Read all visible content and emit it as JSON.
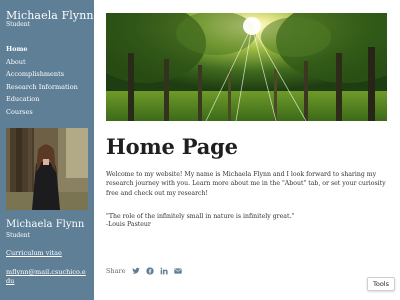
{
  "sidebar": {
    "site_title": "Michaela Flynn",
    "site_subtitle": "Student",
    "nav": [
      {
        "label": "Home",
        "active": true
      },
      {
        "label": "About",
        "active": false
      },
      {
        "label": "Accomplishments",
        "active": false
      },
      {
        "label": "Research Information",
        "active": false
      },
      {
        "label": "Education",
        "active": false
      },
      {
        "label": "Courses",
        "active": false
      }
    ],
    "profile": {
      "name": "Michaela Flynn",
      "role": "Student",
      "cv_label": "Curriculum vitae",
      "email": "mflynn@mail.csuchico.edu"
    }
  },
  "main": {
    "page_title": "Home Page",
    "intro": "Welcome to my website! My name is Michaela Flynn and I look forward to sharing my research journey with you. Learn more about me in the \"About\" tab, or set your curiosity free and check out my research!",
    "quote": "\"The role of the infinitely small in nature is infinitely great.\"",
    "quote_author": "-Louis Pasteur",
    "share_label": "Share"
  },
  "icons": {
    "share": [
      "twitter-icon",
      "facebook-icon",
      "linkedin-icon",
      "email-icon"
    ]
  },
  "colors": {
    "sidebar_bg": "#5e7f96",
    "icon_color": "#5e7f96"
  },
  "tools_button": "Tools"
}
